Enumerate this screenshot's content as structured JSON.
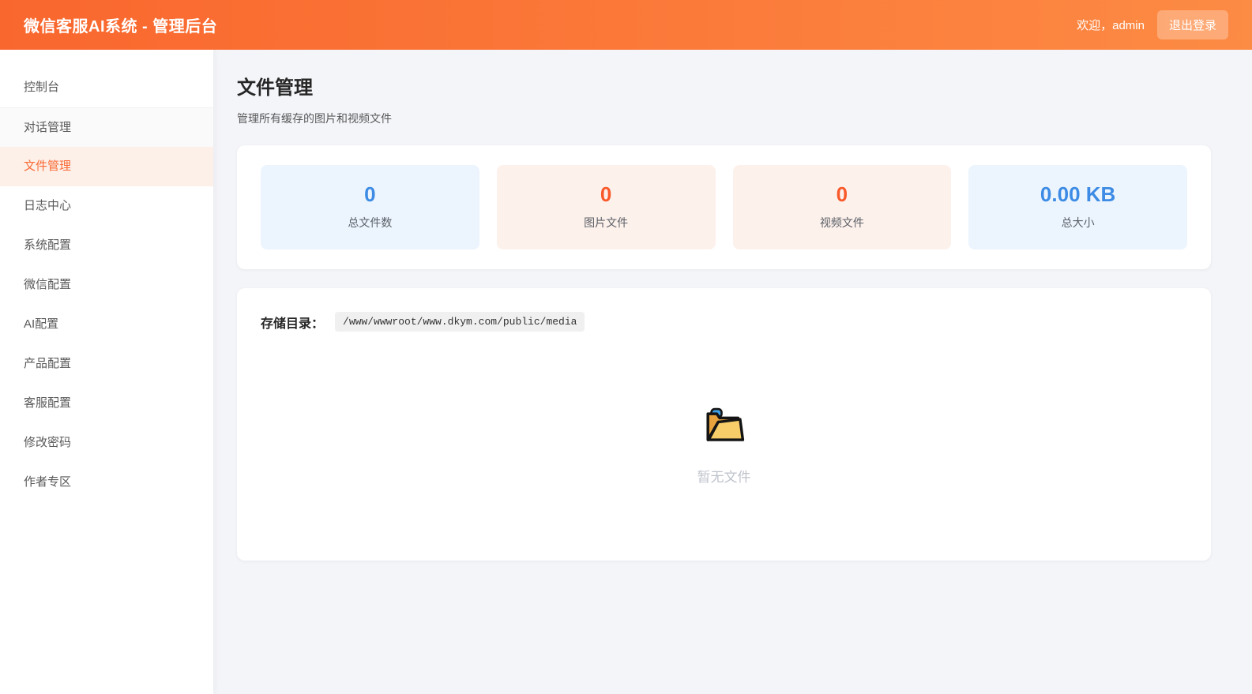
{
  "header": {
    "title": "微信客服AI系统 - 管理后台",
    "welcome": "欢迎，admin",
    "logout_label": "退出登录"
  },
  "sidebar": {
    "items": [
      {
        "label": "控制台",
        "state": "normal"
      },
      {
        "label": "对话管理",
        "state": "hover"
      },
      {
        "label": "文件管理",
        "state": "active"
      },
      {
        "label": "日志中心",
        "state": "normal"
      },
      {
        "label": "系统配置",
        "state": "normal"
      },
      {
        "label": "微信配置",
        "state": "normal"
      },
      {
        "label": "AI配置",
        "state": "normal"
      },
      {
        "label": "产品配置",
        "state": "normal"
      },
      {
        "label": "客服配置",
        "state": "normal"
      },
      {
        "label": "修改密码",
        "state": "normal"
      },
      {
        "label": "作者专区",
        "state": "normal"
      }
    ]
  },
  "page": {
    "title": "文件管理",
    "subtitle": "管理所有缓存的图片和视频文件"
  },
  "stats": {
    "cards": [
      {
        "value": "0",
        "label": "总文件数",
        "theme": "blue"
      },
      {
        "value": "0",
        "label": "图片文件",
        "theme": "orange"
      },
      {
        "value": "0",
        "label": "视频文件",
        "theme": "orange"
      },
      {
        "value": "0.00 KB",
        "label": "总大小",
        "theme": "blue"
      }
    ]
  },
  "storage": {
    "label": "存储目录：",
    "path": "/www/wwwroot/www.dkym.com/public/media"
  },
  "empty": {
    "icon": "open-folder-icon",
    "text": "暂无文件"
  },
  "colors": {
    "header_gradient_start": "#f9672e",
    "header_gradient_end": "#fc8b44",
    "accent_orange": "#f96a35",
    "accent_blue": "#3d8be4",
    "stat_blue_bg": "#ecf5fe",
    "stat_orange_bg": "#fdf1ec",
    "page_bg": "#f4f5f9"
  }
}
